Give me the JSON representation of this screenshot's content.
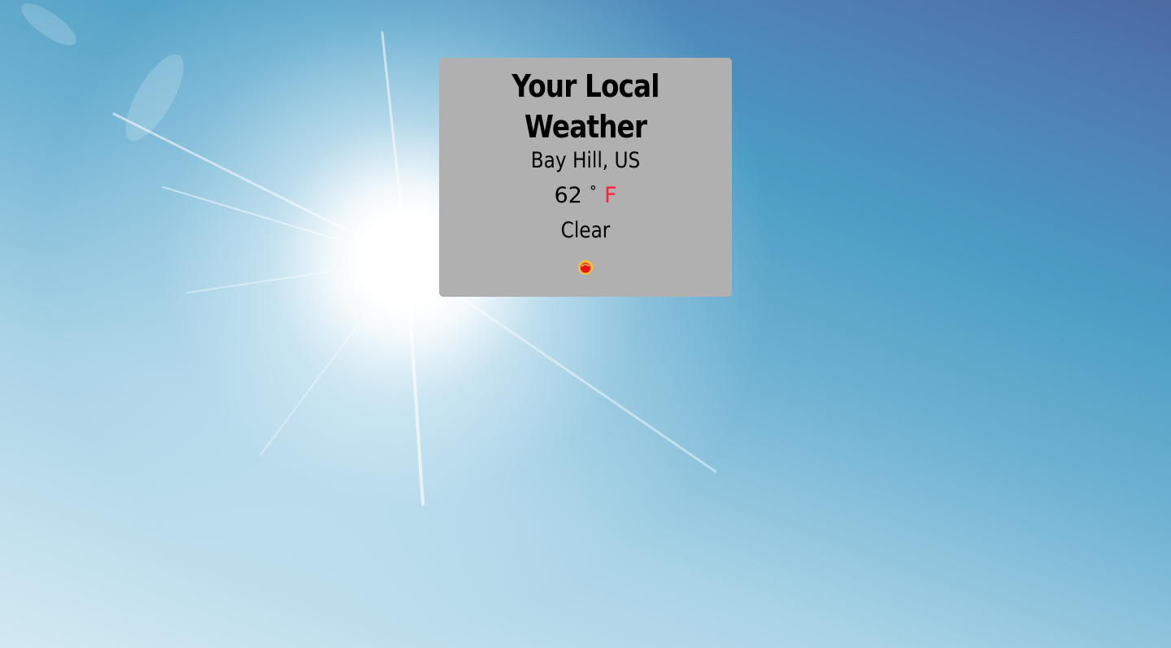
{
  "page": {
    "title": "Your Local Weather"
  },
  "weather": {
    "location": "Bay Hill, US",
    "temperature": "62",
    "degree_symbol": "˚",
    "unit": "F",
    "condition": "Clear",
    "icon": "sun-icon"
  },
  "colors": {
    "card_background": "#b0b0b0",
    "unit_color": "#ff1e3c",
    "sky_top": "#4b6aa2",
    "sky_bottom": "#d3e9f2"
  }
}
